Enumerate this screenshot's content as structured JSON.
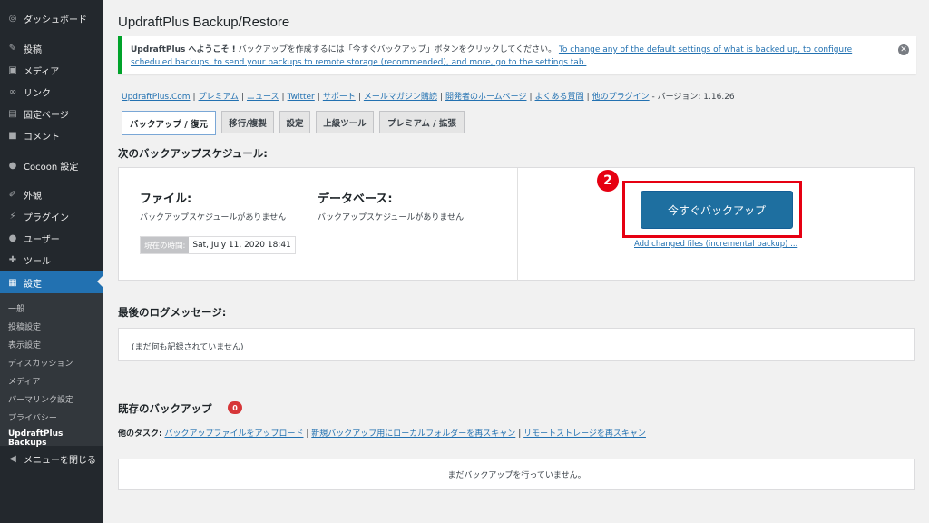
{
  "sidebar": {
    "items": [
      {
        "icon": "dashboard-icon",
        "glyph": "◎",
        "label": "ダッシュボード"
      },
      {
        "icon": "pin-icon",
        "glyph": "✎",
        "label": "投稿"
      },
      {
        "icon": "media-icon",
        "glyph": "▣",
        "label": "メディア"
      },
      {
        "icon": "link-icon",
        "glyph": "∞",
        "label": "リンク"
      },
      {
        "icon": "page-icon",
        "glyph": "▤",
        "label": "固定ページ"
      },
      {
        "icon": "comment-icon",
        "glyph": "■",
        "label": "コメント"
      },
      {
        "icon": "cocoon-icon",
        "glyph": "●",
        "label": "Cocoon 設定"
      },
      {
        "icon": "appearance-icon",
        "glyph": "✐",
        "label": "外観"
      },
      {
        "icon": "plugin-icon",
        "glyph": "⚡",
        "label": "プラグイン"
      },
      {
        "icon": "user-icon",
        "glyph": "●",
        "label": "ユーザー"
      },
      {
        "icon": "tools-icon",
        "glyph": "✚",
        "label": "ツール"
      },
      {
        "icon": "settings-icon",
        "glyph": "▦",
        "label": "設定"
      }
    ],
    "submenu": [
      "一般",
      "投稿設定",
      "表示設定",
      "ディスカッション",
      "メディア",
      "パーマリンク設定",
      "プライバシー",
      "UpdraftPlus Backups"
    ],
    "collapse": {
      "icon": "collapse-icon",
      "glyph": "◀",
      "label": "メニューを閉じる"
    }
  },
  "page": {
    "title": "UpdraftPlus Backup/Restore"
  },
  "notice": {
    "bold": "UpdraftPlus へようこそ !",
    "text": " バックアップを作成するには「今すぐバックアップ」ボタンをクリックしてください。 ",
    "link": "To change any of the default settings of what is backed up, to configure scheduled backups, to send your backups to remote storage (recommended), and more, go to the settings tab.",
    "close_glyph": "✕"
  },
  "links": {
    "items": [
      "UpdraftPlus.Com",
      "プレミアム",
      "ニュース",
      "Twitter",
      "サポート",
      "メールマガジン購読",
      "開発者のホームページ",
      "よくある質問",
      "他のプラグイン"
    ],
    "version": " - バージョン: 1.16.26"
  },
  "tabs": [
    "バックアップ / 復元",
    "移行/複製",
    "設定",
    "上級ツール",
    "プレミアム / 拡張"
  ],
  "schedule": {
    "heading": "次のバックアップスケジュール:",
    "files_title": "ファイル:",
    "files_sub": "バックアップスケジュールがありません",
    "db_title": "データベース:",
    "db_sub": "バックアップスケジュールがありません",
    "time_label": "現在の時間:",
    "time_value": "Sat, July 11, 2020 18:41",
    "button_label": "今すぐバックアップ",
    "step_badge": "2",
    "incremental_link": "Add changed files (incremental backup) ..."
  },
  "log": {
    "heading": "最後のログメッセージ:",
    "message": "(まだ何も記録されていません)"
  },
  "existing": {
    "heading": "既存のバックアップ",
    "count": "0",
    "tasks_label": "他のタスク:",
    "tasks": [
      "バックアップファイルをアップロード",
      "新規バックアップ用にローカルフォルダーを再スキャン",
      "リモートストレージを再スキャン"
    ],
    "empty": "まだバックアップを行っていません。"
  },
  "colors": {
    "sidebar_bg": "#23282d",
    "active": "#2271b1",
    "highlight": "#e60012",
    "button": "#1e6fa0"
  }
}
